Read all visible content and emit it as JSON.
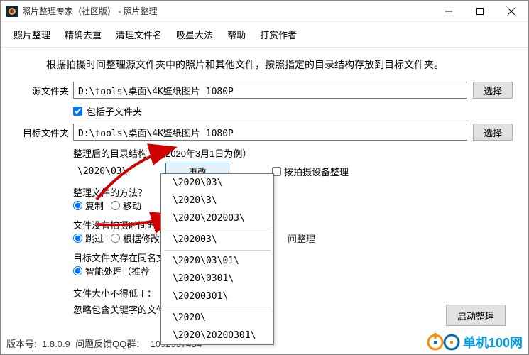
{
  "window": {
    "title": "照片整理专家（社区版） - 照片整理"
  },
  "menu": {
    "items": [
      "照片整理",
      "精确去重",
      "清理文件名",
      "吸星大法",
      "帮助",
      "打赏作者"
    ]
  },
  "intro": "根据拍摄时间整理源文件夹中的照片和其他文件，按照指定的目录结构存放到目标文件夹。",
  "source": {
    "label": "源文件夹",
    "value": "D:\\tools\\桌面\\4K壁纸图片 1080P",
    "browse": "选择",
    "include_sub_label": "包括子文件夹",
    "include_sub_checked": true
  },
  "target": {
    "label": "目标文件夹",
    "value": "D:\\tools\\桌面\\4K壁纸图片 1080P",
    "browse": "选择"
  },
  "structure": {
    "heading": "整理后的目录结构（以2020年3月1日为例）",
    "current": "\\2020\\03\\",
    "change_btn": "更改",
    "by_device_label": "按拍摄设备整理",
    "by_device_checked": false,
    "options": [
      "\\2020\\03\\",
      "\\2020\\3\\",
      "\\2020\\202003\\",
      "\\202003\\",
      "\\2020\\03\\01\\",
      "\\2020\\0301\\",
      "\\20200301\\",
      "\\2020\\",
      "\\2020\\20200301\\"
    ]
  },
  "method": {
    "heading": "整理文件的方法？",
    "opt_copy": "复制",
    "opt_move": "移动",
    "selected": "copy"
  },
  "no_time": {
    "heading": "文件没有拍摄时间时？",
    "opt_skip": "跳过",
    "opt_mod": "根据修改",
    "partial_tail": "间整理",
    "selected": "skip"
  },
  "same_name": {
    "heading": "目标文件夹存在同名文",
    "opt_smart": "智能处理（推荐"
  },
  "size": {
    "heading": "文件大小不得低于：",
    "ignore_heading": "忽略包含关键字的文件"
  },
  "start_btn": "启动整理",
  "footer": {
    "version_label": "版本号:",
    "version": "1.8.0.9",
    "qq_label": "问题反馈QQ群：",
    "qq": "1092957484"
  },
  "brand": "单机100网"
}
